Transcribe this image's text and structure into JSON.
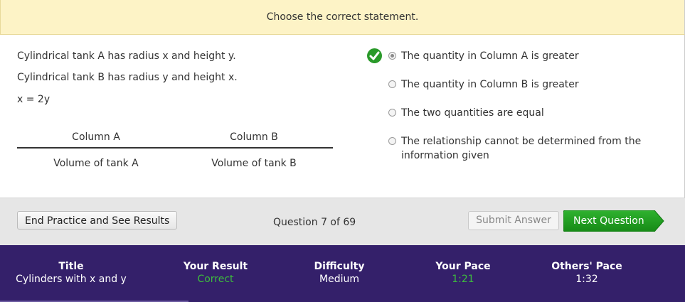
{
  "instruction": "Choose the correct statement.",
  "stem": [
    "Cylindrical tank A has radius x and height y.",
    "Cylindrical tank B has radius y and height x.",
    "x = 2y"
  ],
  "columns": {
    "headers": [
      "Column A",
      "Column B"
    ],
    "values": [
      "Volume of tank A",
      "Volume of tank B"
    ]
  },
  "answers": [
    {
      "label": "The quantity in Column A is greater",
      "selected": true,
      "correct": true
    },
    {
      "label": "The quantity in Column B is greater",
      "selected": false
    },
    {
      "label": "The two quantities are equal",
      "selected": false
    },
    {
      "label": "The relationship cannot be determined from the information given",
      "selected": false
    }
  ],
  "toolbar": {
    "end_label": "End Practice and See Results",
    "question_count": "Question 7 of 69",
    "submit_label": "Submit Answer",
    "next_label": "Next Question"
  },
  "footer": {
    "title_h": "Title",
    "title_v": "Cylinders with x and y",
    "result_h": "Your Result",
    "result_v": "Correct",
    "difficulty_h": "Difficulty",
    "difficulty_v": "Medium",
    "pace_h": "Your Pace",
    "pace_v": "1:21",
    "others_h": "Others' Pace",
    "others_v": "1:32"
  },
  "colors": {
    "banner": "#fdf3c6",
    "correct_green": "#2a9a2a",
    "footer_purple": "#34206a",
    "next_button": "#1f9a1f"
  }
}
